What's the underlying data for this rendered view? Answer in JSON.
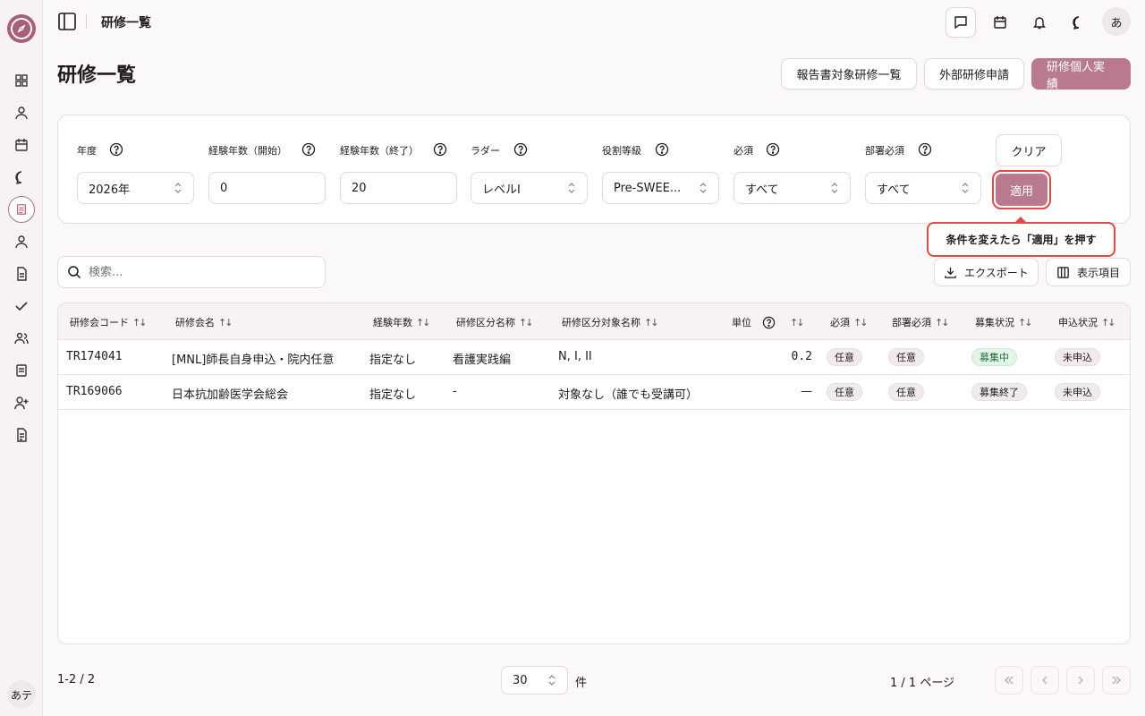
{
  "topbar": {
    "title": "研修一覧",
    "avatar": "あ"
  },
  "rail": {
    "avatar": "あテ"
  },
  "page": {
    "title": "研修一覧",
    "buttons": {
      "report": "報告書対象研修一覧",
      "external": "外部研修申請",
      "personal": "研修個人実績"
    }
  },
  "filters": {
    "year": {
      "label": "年度",
      "value": "2026年"
    },
    "exp_start": {
      "label": "経験年数（開始）",
      "value": "0"
    },
    "exp_end": {
      "label": "経験年数（終了）",
      "value": "20"
    },
    "ladder": {
      "label": "ラダー",
      "value": "レベルI"
    },
    "grade": {
      "label": "役割等級",
      "value": "Pre-SWEE..."
    },
    "required": {
      "label": "必須",
      "value": "すべて"
    },
    "dept_required": {
      "label": "部署必須",
      "value": "すべて"
    },
    "clear": "クリア",
    "apply": "適用"
  },
  "tooltip": "条件を変えたら「適用」を押す",
  "search": {
    "placeholder": "検索..."
  },
  "tools": {
    "export": "エクスポート",
    "columns": "表示項目"
  },
  "table": {
    "headers": {
      "code": "研修会コード",
      "name": "研修会名",
      "exp": "経験年数",
      "category": "研修区分名称",
      "target": "研修区分対象名称",
      "unit": "単位",
      "required": "必須",
      "dept_required": "部署必須",
      "recruit": "募集状況",
      "apply": "申込状況"
    },
    "rows": [
      {
        "code": "TR174041",
        "name": "[MNL]師長自身申込・院内任意",
        "exp": "指定なし",
        "category": "看護実践編",
        "target": "N, I, II",
        "unit": "0.2",
        "required": "任意",
        "dept_required": "任意",
        "recruit": "募集中",
        "apply": "未申込"
      },
      {
        "code": "TR169066",
        "name": "日本抗加齢医学会総会",
        "exp": "指定なし",
        "category": "-",
        "target": "対象なし（誰でも受講可）",
        "unit": "—",
        "required": "任意",
        "dept_required": "任意",
        "recruit": "募集終了",
        "apply": "未申込"
      }
    ]
  },
  "footer": {
    "count": "1-2 / 2",
    "per_page": "30",
    "per_unit": "件",
    "page_info": "1 / 1 ページ"
  },
  "colors": {
    "accent": "#b87a8c",
    "highlight": "#e24a4a",
    "green": "#1f6b3a"
  }
}
